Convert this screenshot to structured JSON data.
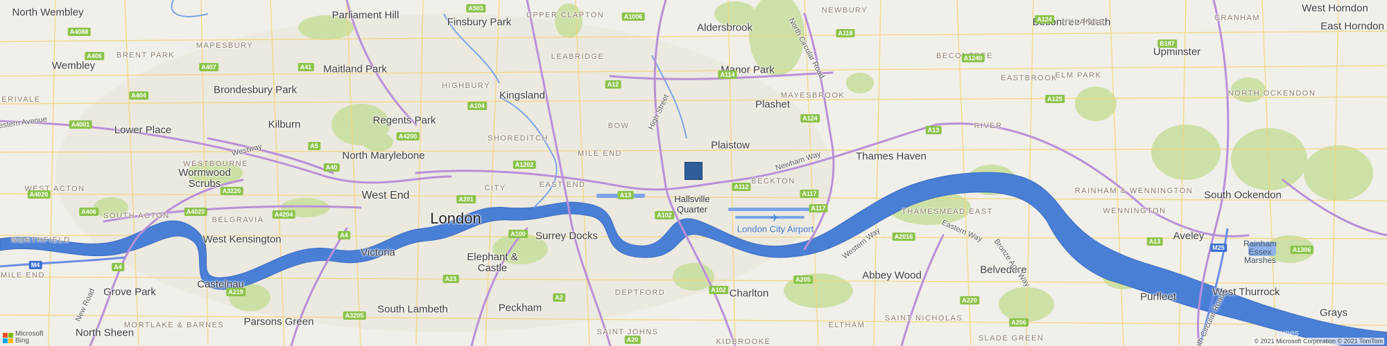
{
  "map": {
    "center_marker": {
      "label_line1": "Hallsville",
      "label_line2": "Quarter"
    },
    "airport": {
      "name": "London City Airport",
      "icon": "airplane-icon"
    },
    "places": [
      {
        "name": "North Wembley",
        "kind": "place"
      },
      {
        "name": "Wembley",
        "kind": "place"
      },
      {
        "name": "Parliament Hill",
        "kind": "place"
      },
      {
        "name": "Finsbury Park",
        "kind": "place"
      },
      {
        "name": "Aldersbrook",
        "kind": "place"
      },
      {
        "name": "Becontree Heath",
        "kind": "place"
      },
      {
        "name": "West Horndon",
        "kind": "place"
      },
      {
        "name": "East Horndon",
        "kind": "place"
      },
      {
        "name": "Maitland Park",
        "kind": "place"
      },
      {
        "name": "Manor Park",
        "kind": "place"
      },
      {
        "name": "Upminster",
        "kind": "place"
      },
      {
        "name": "Brondesbury Park",
        "kind": "place"
      },
      {
        "name": "Kingsland",
        "kind": "place"
      },
      {
        "name": "Plashet",
        "kind": "place"
      },
      {
        "name": "Kilburn",
        "kind": "place"
      },
      {
        "name": "Regents Park",
        "kind": "place"
      },
      {
        "name": "Lower Place",
        "kind": "place"
      },
      {
        "name": "Plaistow",
        "kind": "place"
      },
      {
        "name": "North Marylebone",
        "kind": "place"
      },
      {
        "name": "Thames Haven",
        "kind": "place"
      },
      {
        "name": "Wormwood Scrubs",
        "kind": "place"
      },
      {
        "name": "West End",
        "kind": "mid"
      },
      {
        "name": "London",
        "kind": "big"
      },
      {
        "name": "South Ockendon",
        "kind": "place"
      },
      {
        "name": "West Kensington",
        "kind": "place"
      },
      {
        "name": "Surrey Docks",
        "kind": "place"
      },
      {
        "name": "Aveley",
        "kind": "place"
      },
      {
        "name": "Victoria",
        "kind": "place"
      },
      {
        "name": "Elephant & Castle",
        "kind": "place"
      },
      {
        "name": "Abbey Wood",
        "kind": "place"
      },
      {
        "name": "Belvedere",
        "kind": "place"
      },
      {
        "name": "Castelnau",
        "kind": "place"
      },
      {
        "name": "Grove Park",
        "kind": "place"
      },
      {
        "name": "Charlton",
        "kind": "place"
      },
      {
        "name": "Purfleet",
        "kind": "place"
      },
      {
        "name": "West Thurrock",
        "kind": "place"
      },
      {
        "name": "Parsons Green",
        "kind": "place"
      },
      {
        "name": "South Lambeth",
        "kind": "place"
      },
      {
        "name": "Peckham",
        "kind": "place"
      },
      {
        "name": "North Sheen",
        "kind": "place"
      },
      {
        "name": "Grays",
        "kind": "place"
      }
    ],
    "districts": [
      "MAPESBURY",
      "BRENT PARK",
      "HIGHBURY",
      "LEABRIDGE",
      "UPPER CLAPTON",
      "NEWBURY",
      "HYLANDS",
      "CRANHAM",
      "BECONTREE",
      "EASTBROOK",
      "ELM PARK",
      "MAYESBROOK",
      "NORTH OCKENDON",
      "SHOREDITCH",
      "BOW",
      "RIVER",
      "MILE END",
      "WESTBOURNE",
      "CITY",
      "EAST END",
      "BECKTON",
      "WEST ACTON",
      "SOUTH ACTON",
      "BELGRAVIA",
      "THAMESMEAD EAST",
      "RAINHAM & WENNINGTON",
      "WENNINGTON",
      "NORTHFIELD",
      "MILE END",
      "DEPTFORD",
      "SAINT JOHNS",
      "ELTHAM",
      "SAINT NICHOLAS",
      "SLADE GREEN",
      "MORTLAKE & BARNES",
      "KIDBROOKE",
      "PERIVALE"
    ],
    "roads": [
      "A503",
      "A1006",
      "A118",
      "A124",
      "B187",
      "A4088",
      "A406",
      "A407",
      "A41",
      "A12",
      "A114",
      "A1240",
      "A125",
      "A404",
      "A104",
      "A124",
      "A4001",
      "A4200",
      "A5",
      "A13",
      "A1202",
      "A40",
      "A4020",
      "A3220",
      "A201",
      "A13",
      "A112",
      "A117",
      "A406",
      "A4204",
      "A4020",
      "A102",
      "A117",
      "A4",
      "A100",
      "A2016",
      "A1306",
      "M4",
      "A4",
      "A219",
      "A23",
      "A205",
      "A220",
      "A3205",
      "A2",
      "A206",
      "A20",
      "M25",
      "A13",
      "A102"
    ],
    "road_names": [
      "North Circular Road",
      "High Street",
      "Newham Way",
      "Western Way",
      "Eastern Way",
      "Bronze Age Way",
      "Westway",
      "Western Avenue",
      "New Road",
      "South Circular Road"
    ],
    "water": [
      "Rainham Essex Marshes",
      "Thames"
    ],
    "attribution": {
      "logo_line1": "Microsoft",
      "logo_line2": "Bing",
      "copyright": "© 2021 Microsoft Corporation © 2021 TomTom"
    },
    "colors": {
      "land": "#f1efe9",
      "water": "#4a7fd6",
      "park": "#c9dfa0",
      "major_road": "#b98fd8",
      "minor_road": "#f5d87a",
      "marker": "#2e5d9a"
    }
  }
}
